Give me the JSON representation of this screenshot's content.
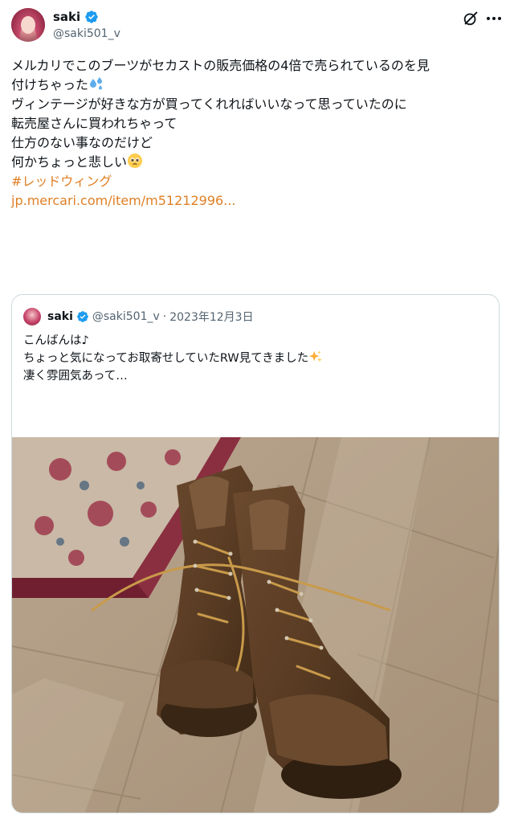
{
  "post": {
    "author_name": "saki",
    "handle": "@saki501_v",
    "lines": [
      "メルカリでこのブーツがセカストの販売価格の4倍で売られているのを見",
      "付けちゃった",
      "ヴィンテージが好きな方が買ってくれればいいなって思っていたのに",
      "転売屋さんに買われちゃって",
      "仕方のない事なのだけど",
      "何かちょっと悲しい"
    ],
    "hashtag": "#レッドウィング",
    "link_text": "jp.mercari.com/item/m51212996..."
  },
  "quote": {
    "author_name": "saki",
    "handle": "@saki501_v",
    "separator": "·",
    "date": "2023年12月3日",
    "lines": [
      "こんばんは♪",
      "ちょっと気になってお取寄せしていたRW見てきました",
      "凄く雰囲気あって…"
    ]
  },
  "icons": {
    "verified": "verified-badge-icon",
    "grok": "grok-icon",
    "more": "more-options-icon",
    "emoji_1": "sweat-droplets-emoji",
    "emoji_2": "pleading-face-emoji",
    "emoji_3": "sparkles-emoji"
  },
  "colors": {
    "link": "#e07f24",
    "verified": "#1d9bf0",
    "secondary_text": "#536471",
    "border": "#cfd9de"
  }
}
